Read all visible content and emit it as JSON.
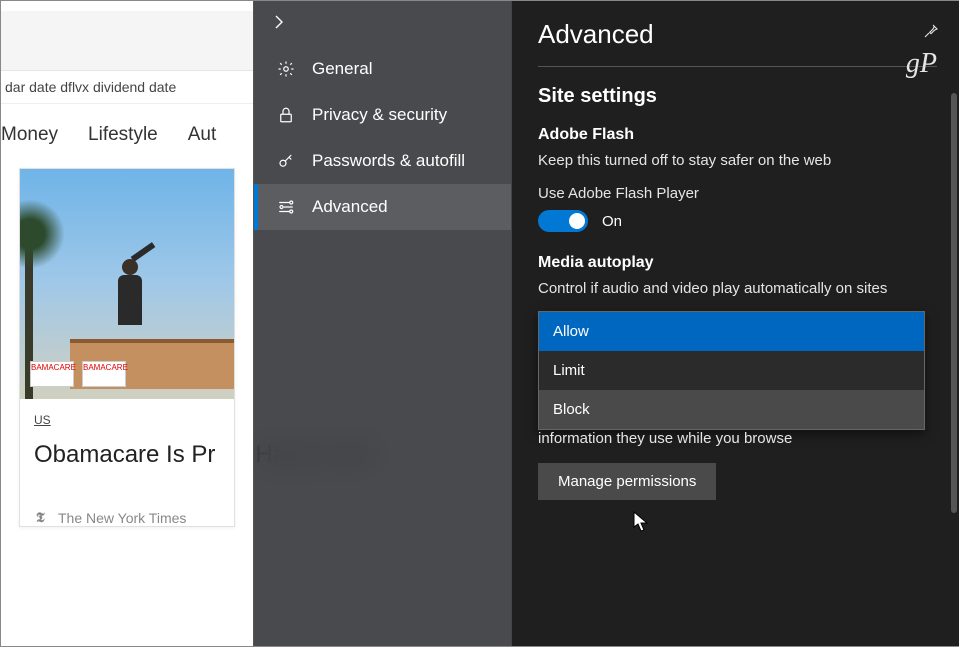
{
  "bg": {
    "search_text": "dar  date   dflvx dividend date",
    "tabs": [
      "Money",
      "Lifestyle",
      "Aut"
    ],
    "sign_text": "BAMACARE",
    "card_tag": "US",
    "card_headline": "Obamacare Is Pr      Hard to Kill",
    "source_name": "The New York Times",
    "source_glyph": "𝕿"
  },
  "sidebar": {
    "items": [
      {
        "label": "General"
      },
      {
        "label": "Privacy & security"
      },
      {
        "label": "Passwords & autofill"
      },
      {
        "label": "Advanced"
      }
    ]
  },
  "panel": {
    "title": "Advanced",
    "watermark": "gP",
    "section_title": "Site settings",
    "flash_title": "Adobe Flash",
    "flash_desc": "Keep this turned off to stay safer on the web",
    "flash_use_label": "Use Adobe Flash Player",
    "flash_toggle_state": "On",
    "media_title": "Media autoplay",
    "media_desc": "Control if audio and video play automatically on sites",
    "dropdown": {
      "options": [
        "Allow",
        "Limit",
        "Block"
      ]
    },
    "behind_text": "information they use while you browse",
    "manage_btn": "Manage permissions"
  }
}
